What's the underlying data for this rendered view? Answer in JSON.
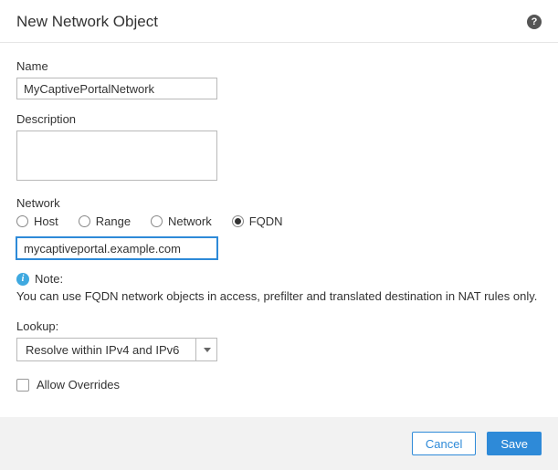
{
  "header": {
    "title": "New Network Object"
  },
  "fields": {
    "name": {
      "label": "Name",
      "value": "MyCaptivePortalNetwork"
    },
    "description": {
      "label": "Description",
      "value": ""
    },
    "network": {
      "label": "Network",
      "options": {
        "host": "Host",
        "range": "Range",
        "network": "Network",
        "fqdn": "FQDN"
      },
      "selected": "fqdn",
      "value": "mycaptiveportal.example.com"
    },
    "note": {
      "label": "Note:",
      "text": "You can use FQDN network objects in access, prefilter and translated destination in NAT rules only."
    },
    "lookup": {
      "label": "Lookup:",
      "value": "Resolve within IPv4 and IPv6"
    },
    "allowOverrides": {
      "label": "Allow Overrides",
      "checked": false
    }
  },
  "footer": {
    "cancel": "Cancel",
    "save": "Save"
  }
}
